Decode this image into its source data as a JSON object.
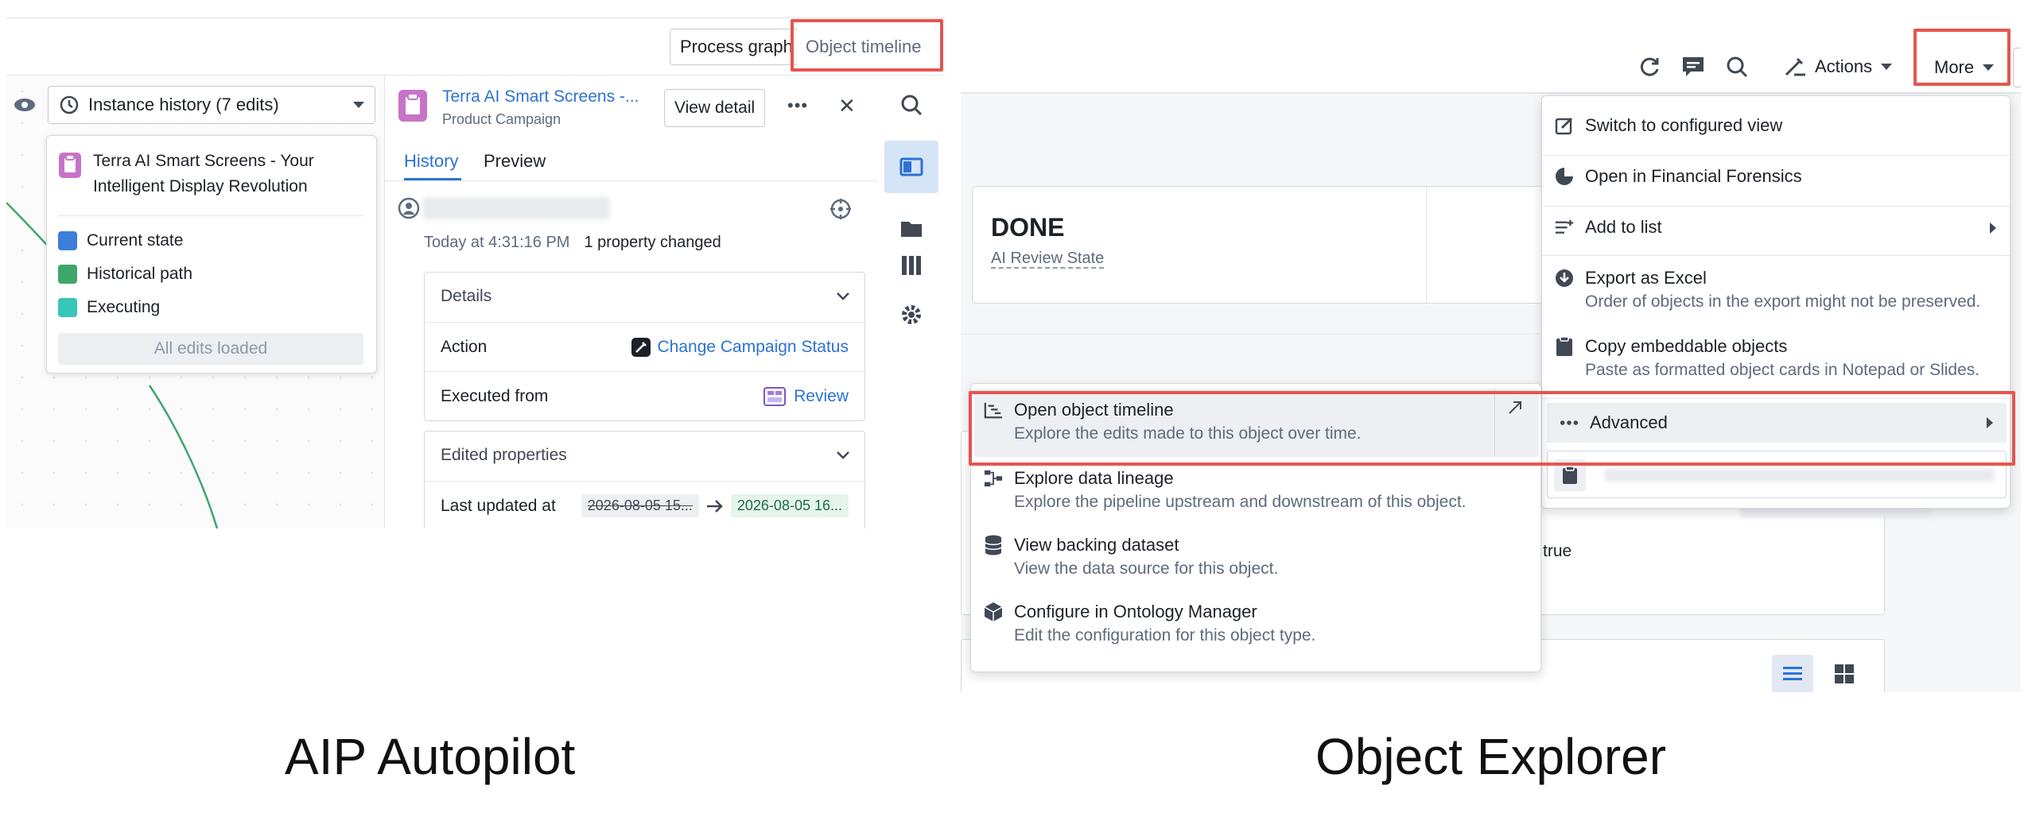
{
  "left": {
    "tabs": {
      "process_graph": "Process graph",
      "object_timeline": "Object timeline"
    },
    "instance_history": "Instance history (7 edits)",
    "popover": {
      "title": "Terra AI Smart Screens - Your Intelligent Display Revolution",
      "legend": [
        {
          "label": "Current state",
          "color": "#3b7fd9"
        },
        {
          "label": "Historical path",
          "color": "#3fa66a"
        },
        {
          "label": "Executing",
          "color": "#37c6b8"
        }
      ],
      "all_loaded": "All edits loaded"
    },
    "object": {
      "title": "Terra AI Smart Screens -...",
      "subtitle": "Product Campaign",
      "view_detail": "View detail",
      "more": "•••",
      "close": "✕"
    },
    "subtabs": {
      "history": "History",
      "preview": "Preview"
    },
    "entry": {
      "time": "Today at 4:31:16 PM",
      "changes": "1 property changed"
    },
    "details": {
      "header": "Details",
      "action_label": "Action",
      "action_value": "Change Campaign Status",
      "executed_label": "Executed from",
      "executed_value": "Review"
    },
    "edited": {
      "header": "Edited properties",
      "prop_label": "Last updated at",
      "old_value": "2026-08-05 15...",
      "new_value": "2026-08-05 16..."
    },
    "caption": "AIP Autopilot"
  },
  "right": {
    "toolbar": {
      "actions": "Actions",
      "more": "More"
    },
    "status": {
      "value": "DONE",
      "label": "AI Review State"
    },
    "more_menu": [
      {
        "title": "Switch to configured view",
        "icon": "edit-icon"
      },
      {
        "title": "Open in Financial Forensics",
        "icon": "pie-icon"
      },
      {
        "title": "Add to list",
        "icon": "list-add-icon"
      },
      {
        "title": "Export as Excel",
        "desc": "Order of objects in the export might not be preserved.",
        "icon": "download-icon"
      },
      {
        "title": "Copy embeddable objects",
        "desc": "Paste as formatted object cards in Notepad or Slides.",
        "icon": "clipboard-icon"
      },
      {
        "title": "Advanced",
        "icon": "more-icon"
      }
    ],
    "advanced_menu": [
      {
        "title": "Open object timeline",
        "desc": "Explore the edits made to this object over time.",
        "icon": "timeline-icon"
      },
      {
        "title": "Explore data lineage",
        "desc": "Explore the pipeline upstream and downstream of this object.",
        "icon": "lineage-icon"
      },
      {
        "title": "View backing dataset",
        "desc": "View the data source for this object.",
        "icon": "database-icon"
      },
      {
        "title": "Configure in Ontology Manager",
        "desc": "Edit the configuration for this object type.",
        "icon": "cube-icon"
      }
    ],
    "true_value": "true",
    "caption": "Object Explorer"
  }
}
